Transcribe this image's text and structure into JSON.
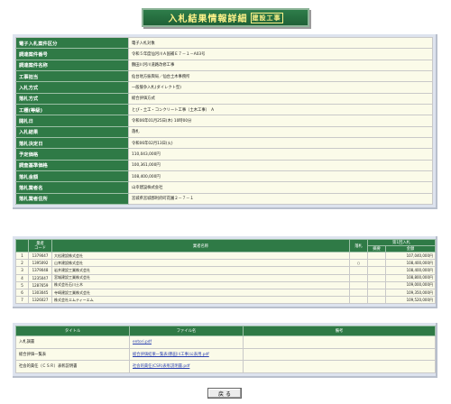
{
  "header": {
    "title": "入札結果情報詳細",
    "subtitle": "建設工事"
  },
  "info_rows": [
    {
      "label": "電子入札案件区分",
      "value": "電子入札対象"
    },
    {
      "label": "調達案件番号",
      "value": "令和５年度仙河川Ａ国補Ｅ７－１－A03号"
    },
    {
      "label": "調達案件名称",
      "value": "鶴田川河川道路改修工事"
    },
    {
      "label": "工事担当",
      "value": "仙台地方振興局／仙台土木事務所"
    },
    {
      "label": "入札方式",
      "value": "一般競争入札(ダイレクト型)"
    },
    {
      "label": "落札方式",
      "value": "総合評価方式"
    },
    {
      "label": "工種(等級)",
      "value": "とび・土工・コンクリート工事（土木工事）　A"
    },
    {
      "label": "開札日",
      "value": "令和06年01月25日(木) 10時00分"
    },
    {
      "label": "入札結果",
      "value": "落札"
    },
    {
      "label": "落札決定日",
      "value": "令和06年02月13日(火)"
    },
    {
      "label": "予定価格",
      "value": "110,043,000円"
    },
    {
      "label": "調査基準価格",
      "value": "100,361,000円"
    },
    {
      "label": "落札金額",
      "value": "108,400,000円"
    },
    {
      "label": "落札業者名",
      "value": "山幸建設株式会社"
    },
    {
      "label": "落札業者住所",
      "value": "宮城県宮城郡利府町花園２－７－１"
    }
  ],
  "bidders": {
    "headers": {
      "no": "",
      "code": "業者\nコード",
      "name": "業者名称",
      "result": "落札",
      "bid_group": "第1回入札",
      "remarks": "摘要",
      "amount": "金額"
    },
    "rows": [
      {
        "no": "1",
        "code": "1379047",
        "name": "大松建設株式会社",
        "result": "",
        "remarks": "",
        "amount": "107,040,000円"
      },
      {
        "no": "2",
        "code": "1395092",
        "name": "山幸建設株式会社",
        "result": "○",
        "remarks": "",
        "amount": "108,400,000円"
      },
      {
        "no": "3",
        "code": "1379048",
        "name": "岩井建設工業株式会社",
        "result": "",
        "remarks": "",
        "amount": "108,400,000円"
      },
      {
        "no": "4",
        "code": "1235047",
        "name": "宮城建設工業株式会社",
        "result": "",
        "remarks": "",
        "amount": "108,800,000円"
      },
      {
        "no": "5",
        "code": "1287659",
        "name": "株式会社石川土木",
        "result": "",
        "remarks": "",
        "amount": "109,000,000円"
      },
      {
        "no": "6",
        "code": "1303045",
        "name": "寺崎建設工業株式会社",
        "result": "",
        "remarks": "",
        "amount": "109,350,000円"
      },
      {
        "no": "7",
        "code": "1326027",
        "name": "株式会社エムティーエム",
        "result": "",
        "remarks": "",
        "amount": "109,520,000円"
      }
    ]
  },
  "documents": {
    "headers": {
      "title": "タイトル",
      "file": "ファイル名",
      "note": "備考"
    },
    "rows": [
      {
        "title": "入札調書",
        "file": "entori.pdf",
        "note": ""
      },
      {
        "title": "総合評価一覧表",
        "file": "総合評価結果一覧表(鶴田川工事)公表用.pdf",
        "note": ""
      },
      {
        "title": "社会的責任（ＣＳＲ）表彰説明書",
        "file": "社会的責任(CSR)表彰説明書.pdf",
        "note": ""
      }
    ]
  },
  "footer": {
    "back_label": "戻 る"
  }
}
